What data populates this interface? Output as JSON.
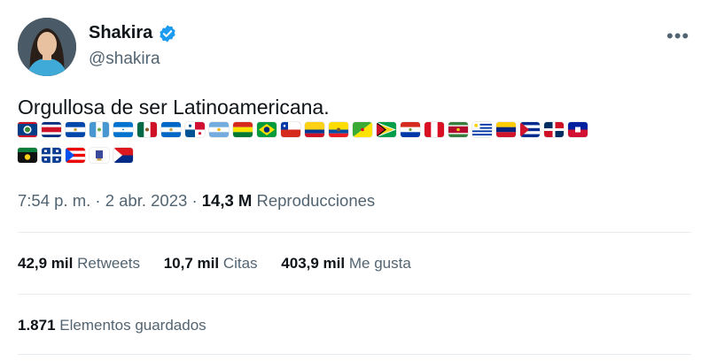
{
  "author": {
    "display_name": "Shakira",
    "handle": "@shakira",
    "verified": true,
    "verified_badge_color": "#1d9bf0"
  },
  "menu": {
    "more_icon": "more-horizontal-icon"
  },
  "tweet": {
    "text": "Orgullosa de ser Latinoamericana.",
    "flag_row_1": [
      "belize",
      "costa-rica",
      "el-salvador",
      "guatemala",
      "honduras",
      "mexico",
      "nicaragua",
      "panama",
      "argentina",
      "bolivia",
      "brazil",
      "chile",
      "colombia",
      "ecuador",
      "french-guiana",
      "guyana",
      "paraguay",
      "peru",
      "suriname",
      "uruguay",
      "venezuela",
      "cuba",
      "dominican-republic",
      "haiti"
    ],
    "flag_row_2": [
      "guadeloupe",
      "martinique",
      "puerto-rico",
      "saint-barthelemy",
      "sint-maarten"
    ]
  },
  "meta": {
    "time": "7:54 p. m.",
    "separator": "·",
    "date": "2 abr. 2023",
    "views_count": "14,3 M",
    "views_label": "Reproducciones"
  },
  "stats": {
    "retweets_count": "42,9 mil",
    "retweets_label": "Retweets",
    "quotes_count": "10,7 mil",
    "quotes_label": "Citas",
    "likes_count": "403,9 mil",
    "likes_label": "Me gusta"
  },
  "bookmarks": {
    "count": "1.871",
    "label": "Elementos guardados"
  },
  "colors": {
    "text": "#0f1419",
    "secondary": "#536471",
    "divider": "#e6ecf0",
    "accent": "#1d9bf0"
  }
}
